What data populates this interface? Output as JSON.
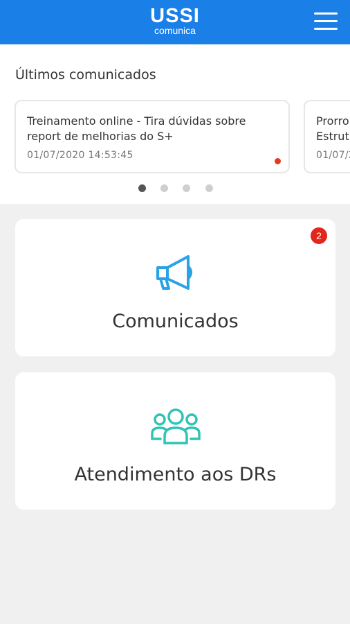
{
  "header": {
    "logo_main": "USSI",
    "logo_sub": "comunica",
    "menu_icon": "hamburger-menu-icon",
    "background": "#1a7fe6"
  },
  "latest": {
    "title": "Últimos comunicados",
    "cards": [
      {
        "title": "Treinamento online - Tira dúvidas sobre report de melhorias do S+",
        "date": "01/07/2020 14:53:45",
        "unread": true
      },
      {
        "title": "Prorro",
        "title_line2": "Estrutu",
        "date": "01/07/2"
      }
    ],
    "pagination": {
      "count": 4,
      "active": 1
    }
  },
  "tiles": [
    {
      "label": "Comunicados",
      "icon": "megaphone-icon",
      "badge": "2",
      "icon_color": "#2aa2e6"
    },
    {
      "label": "Atendimento aos DRs",
      "icon": "people-group-icon",
      "icon_color": "#2ec4b6"
    }
  ],
  "colors": {
    "badge": "#e3261c",
    "unread_dot": "#e63a1e",
    "background": "#f0f0f0"
  }
}
